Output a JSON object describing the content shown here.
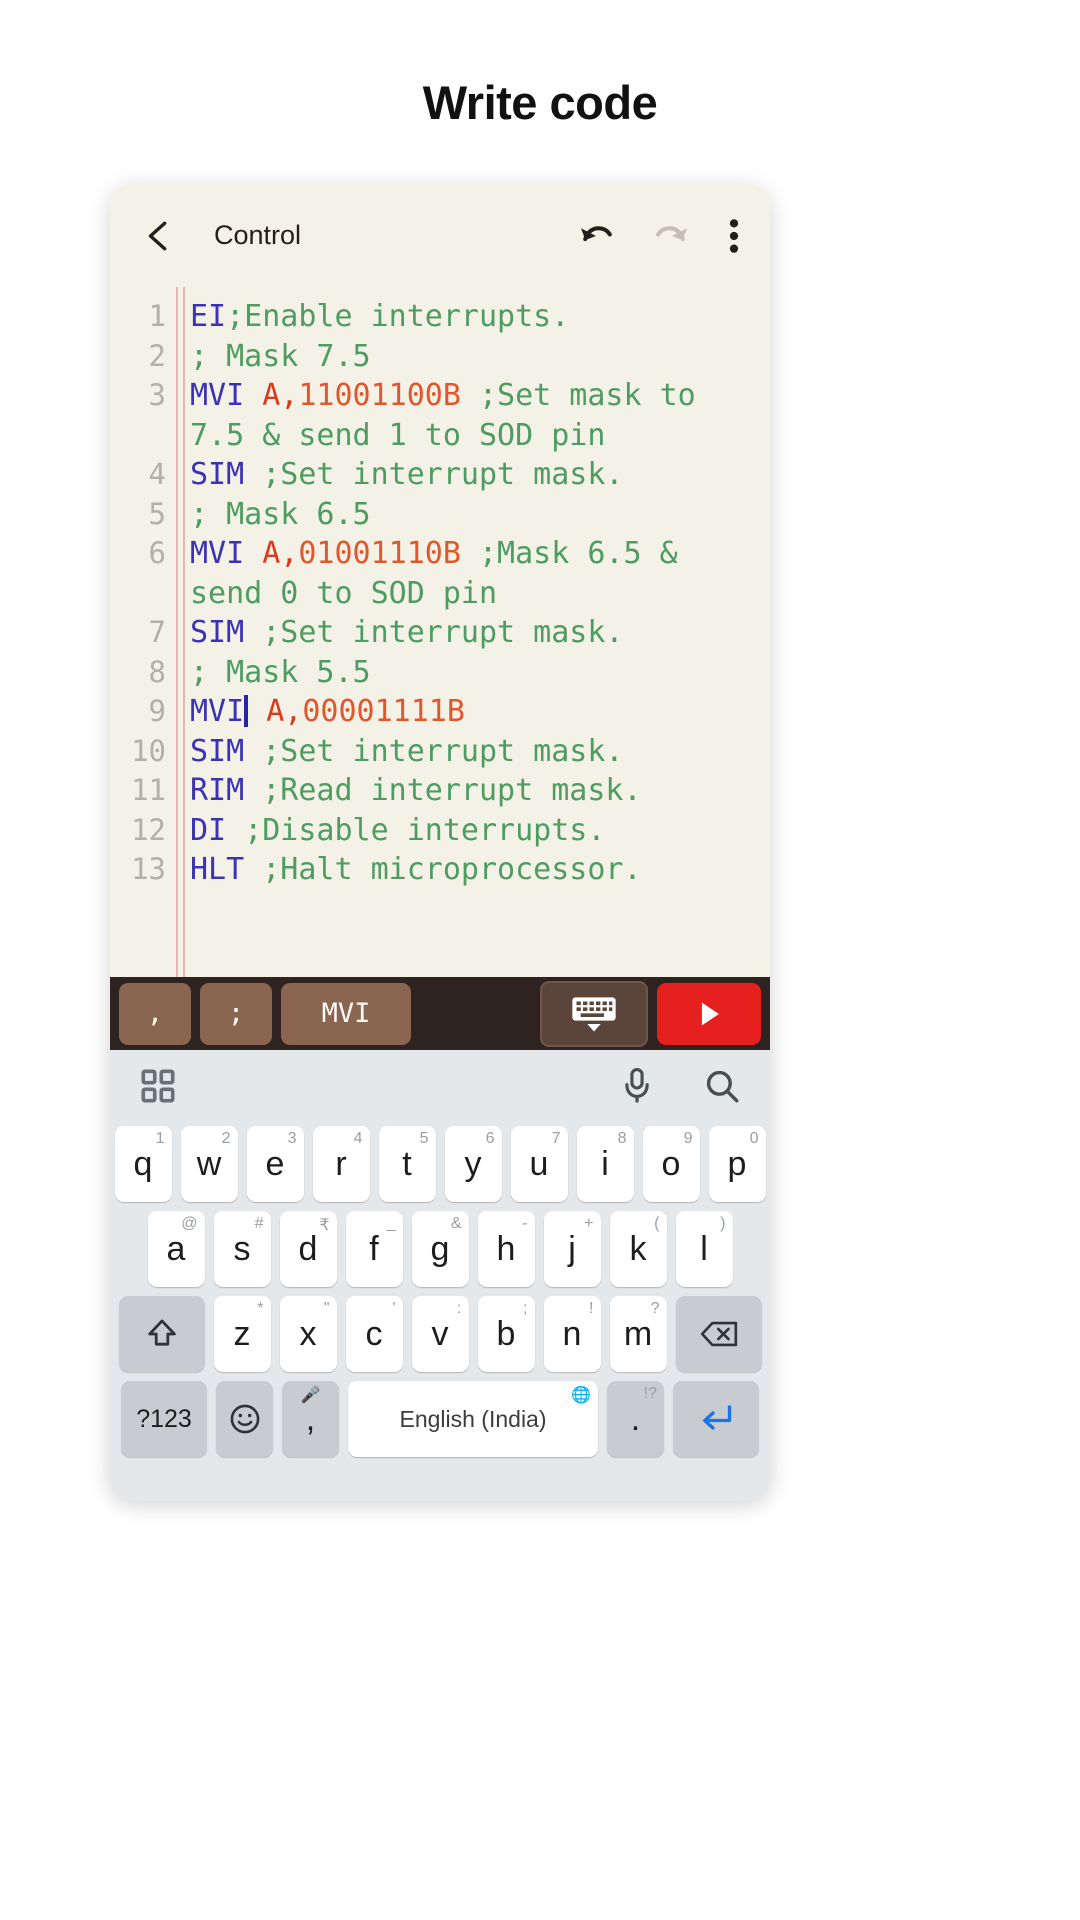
{
  "page": {
    "title": "Write code"
  },
  "appbar": {
    "title": "Control",
    "back_icon": "chevron-left-icon",
    "undo_icon": "undo-icon",
    "redo_icon": "redo-icon",
    "menu_icon": "more-vertical-icon"
  },
  "editor": {
    "line_numbers": [
      "1",
      "2",
      "3",
      "4",
      "5",
      "6",
      "7",
      "8",
      "9",
      "10",
      "11",
      "12",
      "13"
    ],
    "lines": [
      {
        "n": 1,
        "kw": "EI",
        "comment": ";Enable interrupts."
      },
      {
        "n": 2,
        "comment": "; Mask 7.5"
      },
      {
        "n": 3,
        "kw": "MVI",
        "reg": "A,",
        "num": "11001100B",
        "comment": ";Set mask to 7.5 & send 1 to SOD pin"
      },
      {
        "n": 4,
        "kw": "SIM",
        "comment": ";Set interrupt mask."
      },
      {
        "n": 5,
        "comment": "; Mask 6.5"
      },
      {
        "n": 6,
        "kw": "MVI",
        "reg": "A,",
        "num": "01001110B",
        "comment": ";Mask 6.5 & send 0 to SOD pin"
      },
      {
        "n": 7,
        "kw": "SIM",
        "comment": ";Set interrupt mask."
      },
      {
        "n": 8,
        "comment": "; Mask 5.5"
      },
      {
        "n": 9,
        "kw": "MVI",
        "reg": "A,",
        "num": "00001111B",
        "comment": "",
        "caret_after_kw": true
      },
      {
        "n": 10,
        "kw": "SIM",
        "comment": ";Set interrupt mask."
      },
      {
        "n": 11,
        "kw": "RIM",
        "comment": ";Read interrupt mask."
      },
      {
        "n": 12,
        "kw": "DI",
        "comment": ";Disable interrupts."
      },
      {
        "n": 13,
        "kw": "HLT",
        "comment": ";Halt microprocessor."
      }
    ],
    "colors": {
      "background": "#f4f1e6",
      "keyword": "#3b32b5",
      "operand": "#d93a1e",
      "number": "#e2562b",
      "comment": "#4f9c63",
      "line_number": "#b3b0a7",
      "caret": "#2a22a8"
    }
  },
  "suggestion_bar": {
    "chips": [
      ",",
      ";",
      "MVI"
    ],
    "keyboard_toggle_icon": "keyboard-hide-icon",
    "run_icon": "play-icon",
    "colors": {
      "bar": "#2e2320",
      "chip": "#8a6550",
      "run": "#e5201f"
    }
  },
  "keyboard": {
    "toolbar": {
      "grid_icon": "grid-menu-icon",
      "mic_icon": "microphone-icon",
      "search_icon": "search-icon"
    },
    "row1": [
      {
        "key": "q",
        "sup": "1"
      },
      {
        "key": "w",
        "sup": "2"
      },
      {
        "key": "e",
        "sup": "3"
      },
      {
        "key": "r",
        "sup": "4"
      },
      {
        "key": "t",
        "sup": "5"
      },
      {
        "key": "y",
        "sup": "6"
      },
      {
        "key": "u",
        "sup": "7"
      },
      {
        "key": "i",
        "sup": "8"
      },
      {
        "key": "o",
        "sup": "9"
      },
      {
        "key": "p",
        "sup": "0"
      }
    ],
    "row2": [
      {
        "key": "a",
        "sup": "@"
      },
      {
        "key": "s",
        "sup": "#"
      },
      {
        "key": "d",
        "sup": "₹"
      },
      {
        "key": "f",
        "sup": "_"
      },
      {
        "key": "g",
        "sup": "&"
      },
      {
        "key": "h",
        "sup": "-"
      },
      {
        "key": "j",
        "sup": "+"
      },
      {
        "key": "k",
        "sup": "("
      },
      {
        "key": "l",
        "sup": ")"
      }
    ],
    "row3": {
      "shift_icon": "shift-up-icon",
      "keys": [
        {
          "key": "z",
          "sup": "*"
        },
        {
          "key": "x",
          "sup": "\""
        },
        {
          "key": "c",
          "sup": "'"
        },
        {
          "key": "v",
          "sup": ":"
        },
        {
          "key": "b",
          "sup": ";"
        },
        {
          "key": "n",
          "sup": "!"
        },
        {
          "key": "m",
          "sup": "?"
        }
      ],
      "backspace_icon": "backspace-icon"
    },
    "row4": {
      "symbols_label": "?123",
      "emoji_icon": "emoji-smiley-icon",
      "comma_key": ",",
      "comma_sup_icon": "microphone-small-icon",
      "space_label": "English (India)",
      "globe_icon": "globe-icon",
      "period_key": ".",
      "period_sup": "!?",
      "enter_icon": "enter-return-icon"
    }
  }
}
